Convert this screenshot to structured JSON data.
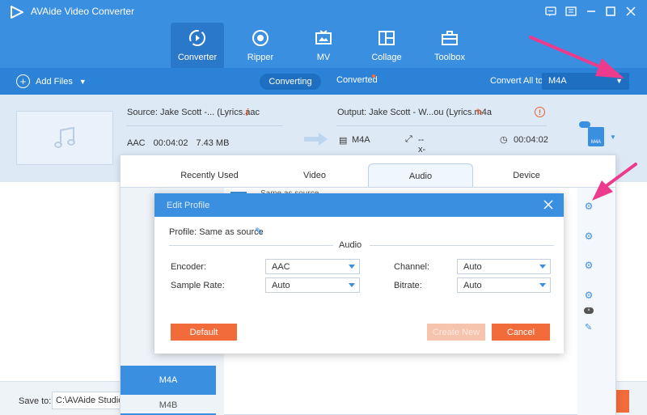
{
  "app": {
    "title": "AVAide Video Converter"
  },
  "nav": [
    {
      "label": "Converter",
      "icon": "converter-icon",
      "active": true
    },
    {
      "label": "Ripper",
      "icon": "ripper-icon"
    },
    {
      "label": "MV",
      "icon": "mv-icon"
    },
    {
      "label": "Collage",
      "icon": "collage-icon"
    },
    {
      "label": "Toolbox",
      "icon": "toolbox-icon"
    }
  ],
  "toolbar": {
    "add_files": "Add Files",
    "tab_converting": "Converting",
    "tab_converted": "Converted",
    "convert_all_label": "Convert All to:",
    "convert_all_value": "M4A"
  },
  "file": {
    "source": "Source: Jake Scott -... (Lyrics.aac",
    "codec": "AAC",
    "duration": "00:04:02",
    "size": "7.43 MB",
    "output": "Output: Jake Scott - W...ou (Lyrics.m4a",
    "out_format": "M4A",
    "out_resolution": "--x--",
    "out_duration": "00:04:02",
    "format_icon_text": "M4A"
  },
  "format_panel": {
    "tabs": [
      "Recently Used",
      "Video",
      "Audio",
      "Device"
    ],
    "active_tab": "Audio",
    "same_as_source": "Same as source",
    "formats": [
      "M4A",
      "M4B"
    ],
    "selected_format": "M4A"
  },
  "dialog": {
    "title": "Edit Profile",
    "profile": "Profile: Same as source",
    "section": "Audio",
    "encoder_label": "Encoder:",
    "encoder_value": "AAC",
    "sample_rate_label": "Sample Rate:",
    "sample_rate_value": "Auto",
    "channel_label": "Channel:",
    "channel_value": "Auto",
    "bitrate_label": "Bitrate:",
    "bitrate_value": "Auto",
    "default_btn": "Default",
    "create_btn": "Create New",
    "cancel_btn": "Cancel"
  },
  "bottom": {
    "save_to_label": "Save to:",
    "save_to_value": "C:\\AVAide Studio\\"
  },
  "colors": {
    "primary": "#3b8fe0",
    "accent": "#f26b3a",
    "annotation": "#ec3a8c"
  }
}
